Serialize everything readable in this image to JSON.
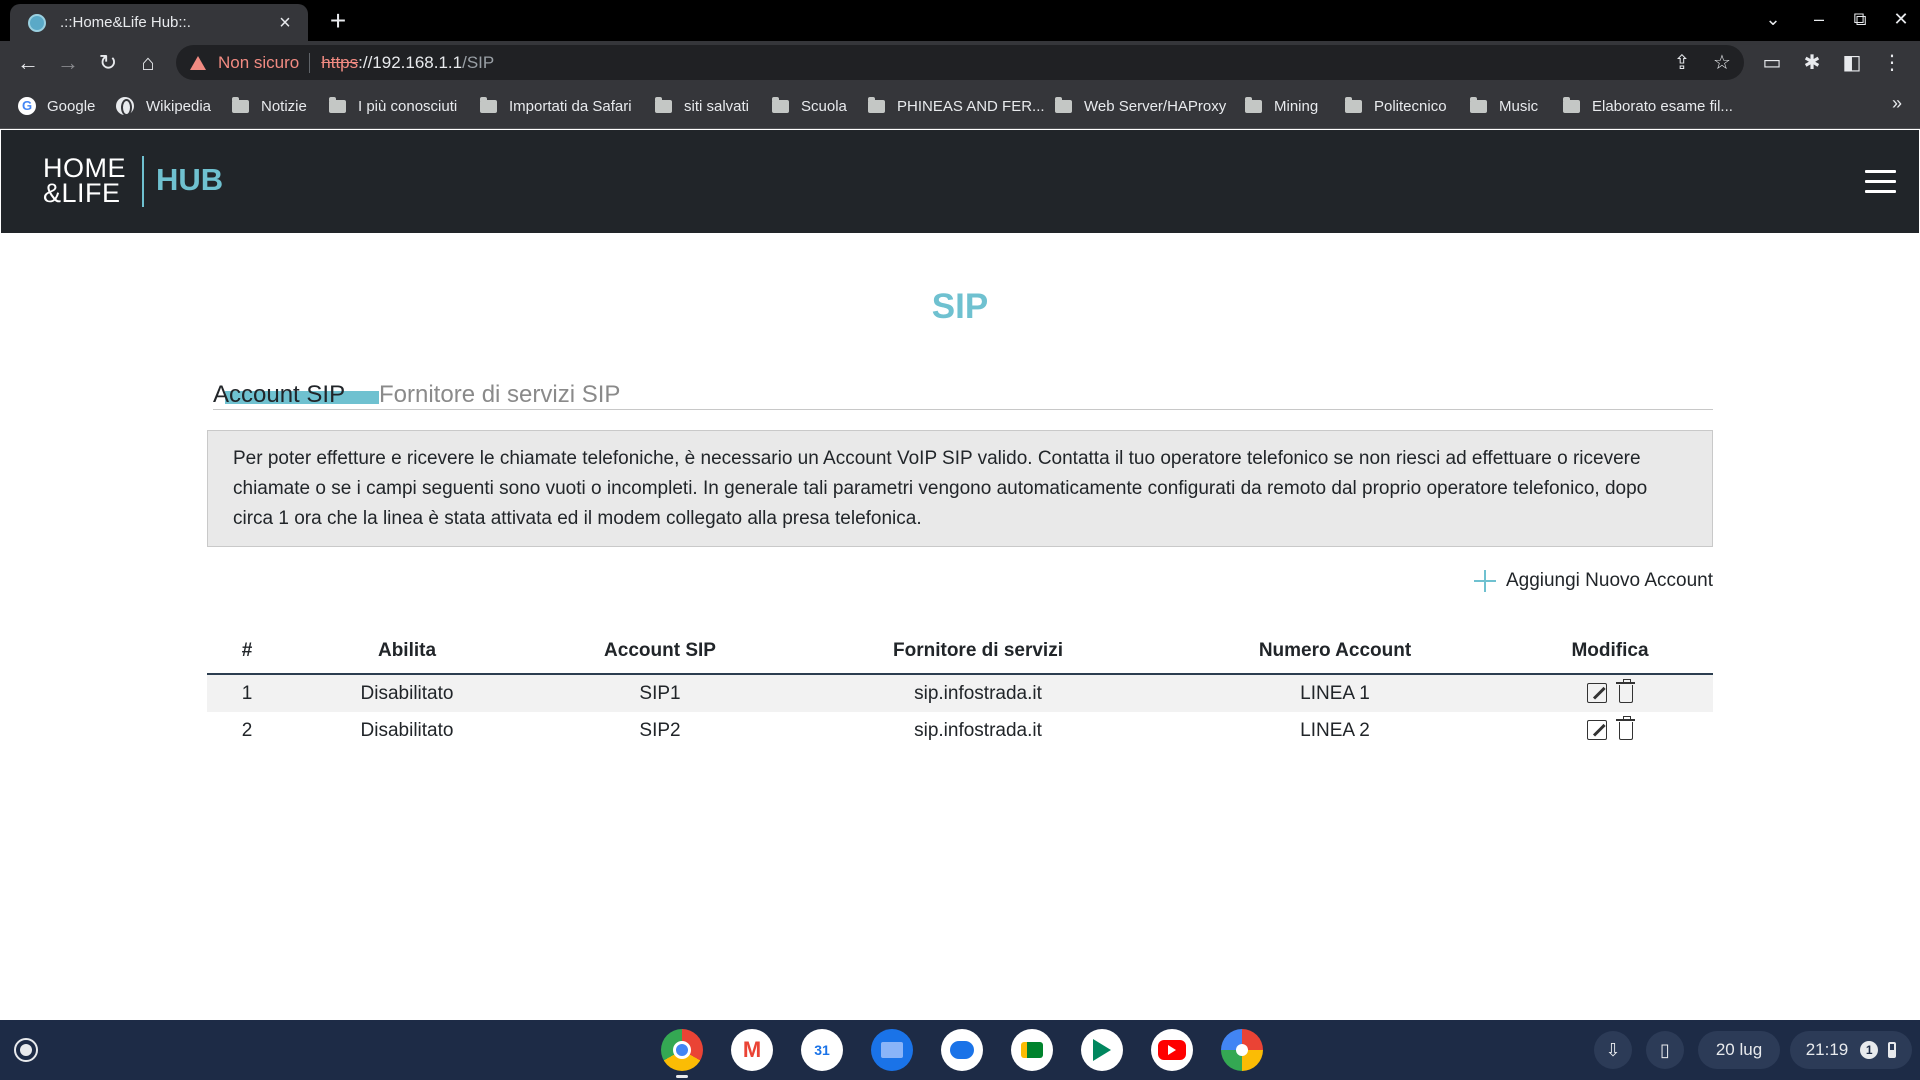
{
  "browser": {
    "tab_title": ".::Home&Life Hub::.",
    "new_tab_symbol": "+",
    "close_symbol": "×",
    "address": {
      "security_label": "Non sicuro",
      "scheme": "https",
      "host": "://192.168.1.1",
      "path": "/SIP"
    },
    "bookmarks": [
      {
        "label": "Google",
        "icon": "google-icon"
      },
      {
        "label": "Wikipedia",
        "icon": "globe-icon"
      },
      {
        "label": "Notizie",
        "icon": "folder-icon"
      },
      {
        "label": "I più conosciuti",
        "icon": "folder-icon"
      },
      {
        "label": "Importati da Safari",
        "icon": "folder-icon"
      },
      {
        "label": "siti salvati",
        "icon": "folder-icon"
      },
      {
        "label": "Scuola",
        "icon": "folder-icon"
      },
      {
        "label": "PHINEAS AND FER...",
        "icon": "folder-icon"
      },
      {
        "label": "Web Server/HAProxy",
        "icon": "folder-icon"
      },
      {
        "label": "Mining",
        "icon": "folder-icon"
      },
      {
        "label": "Politecnico",
        "icon": "folder-icon"
      },
      {
        "label": "Music",
        "icon": "folder-icon"
      },
      {
        "label": "Elaborato esame fil...",
        "icon": "folder-icon"
      }
    ],
    "bookmarks_overflow": "»"
  },
  "header": {
    "logo_line1": "HOME",
    "logo_line2": "&LIFE",
    "logo_hub": "HUB"
  },
  "page": {
    "title": "SIP",
    "tabs": [
      {
        "label": "Account SIP",
        "active": true
      },
      {
        "label": "Fornitore di servizi SIP",
        "active": false
      }
    ],
    "info_text": "Per poter effetture e ricevere le chiamate telefoniche, è necessario un Account VoIP SIP valido. Contatta il tuo operatore telefonico se non riesci ad effettuare o ricevere chiamate o se i campi seguenti sono vuoti o incompleti. In generale tali parametri vengono automaticamente configurati da remoto dal proprio operatore telefonico, dopo circa 1 ora che la linea è stata attivata ed il modem collegato alla presa telefonica.",
    "add_account_label": "Aggiungi Nuovo Account",
    "table": {
      "headers": [
        "#",
        "Abilita",
        "Account SIP",
        "Fornitore di servizi",
        "Numero Account",
        "Modifica"
      ],
      "rows": [
        [
          "1",
          "Disabilitato",
          "SIP1",
          "sip.infostrada.it",
          "LINEA 1"
        ],
        [
          "2",
          "Disabilitato",
          "SIP2",
          "sip.infostrada.it",
          "LINEA 2"
        ]
      ]
    }
  },
  "shelf": {
    "apps": [
      "chrome-icon",
      "gmail-icon",
      "calendar-icon",
      "files-icon",
      "messages-icon",
      "meet-icon",
      "play-store-icon",
      "youtube-icon",
      "photos-icon"
    ],
    "calendar_day": "31",
    "date": "20 lug",
    "time": "21:19",
    "notification_count": "1"
  },
  "colors": {
    "accent": "#6fc1d0",
    "header_bg": "#212529",
    "shelf_bg": "#1d2b46",
    "warning": "#f28b82"
  }
}
